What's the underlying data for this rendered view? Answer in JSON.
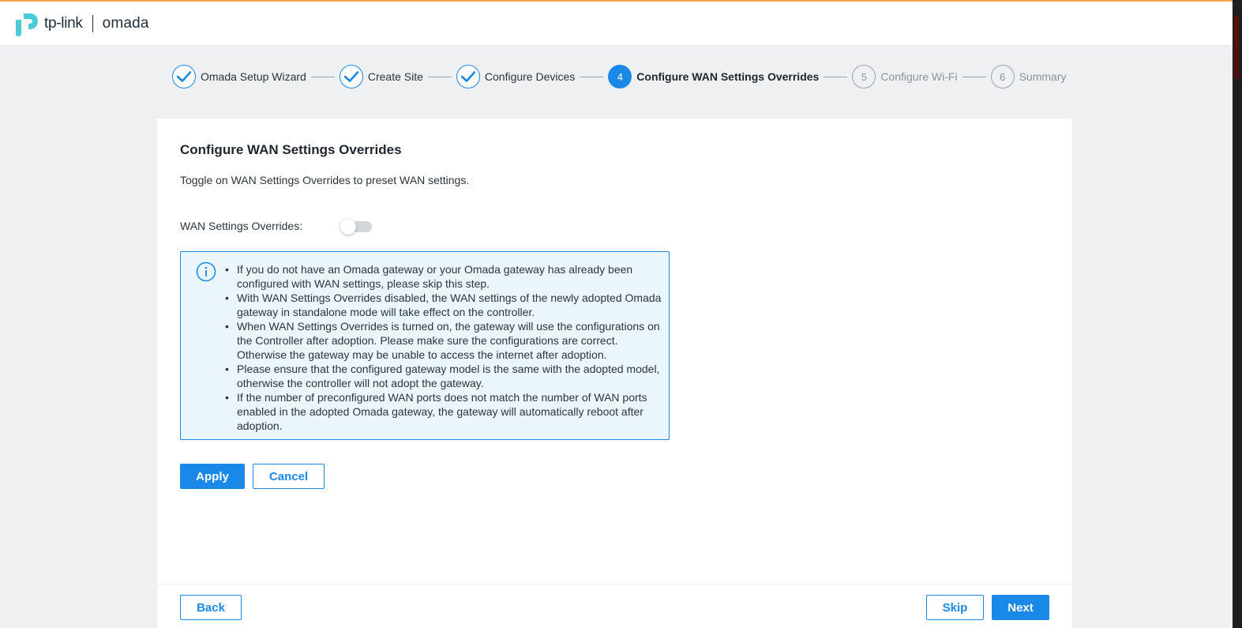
{
  "brand": {
    "tplink": "tp-link",
    "omada": "omada",
    "accent": "#1a88e6"
  },
  "wizard": {
    "steps": [
      {
        "number": "1",
        "label": "Omada Setup Wizard",
        "state": "done"
      },
      {
        "number": "2",
        "label": "Create Site",
        "state": "done"
      },
      {
        "number": "3",
        "label": "Configure Devices",
        "state": "done"
      },
      {
        "number": "4",
        "label": "Configure WAN Settings Overrides",
        "state": "current"
      },
      {
        "number": "5",
        "label": "Configure Wi-Fi",
        "state": "future"
      },
      {
        "number": "6",
        "label": "Summary",
        "state": "future"
      }
    ]
  },
  "main": {
    "title": "Configure WAN Settings Overrides",
    "description": "Toggle on WAN Settings Overrides to preset WAN settings.",
    "toggle": {
      "label": "WAN Settings Overrides:",
      "enabled": false
    },
    "info_icon": "info-circle-icon",
    "info_items": [
      "If you do not have an Omada gateway or your Omada gateway has already been configured with WAN settings, please skip this step.",
      "With WAN Settings Overrides disabled, the WAN settings of the newly adopted Omada gateway in standalone mode will take effect on the controller.",
      "When WAN Settings Overrides is turned on, the gateway will use the configurations on the Controller after adoption. Please make sure the configurations are correct. Otherwise the gateway may be unable to access the internet after adoption.",
      "Please ensure that the configured gateway model is the same with the adopted model, otherwise the controller will not adopt the gateway.",
      "If the number of preconfigured WAN ports does not match the number of WAN ports enabled in the adopted Omada gateway, the gateway will automatically reboot after adoption."
    ],
    "apply_label": "Apply",
    "cancel_label": "Cancel"
  },
  "footer": {
    "back_label": "Back",
    "skip_label": "Skip",
    "next_label": "Next"
  }
}
